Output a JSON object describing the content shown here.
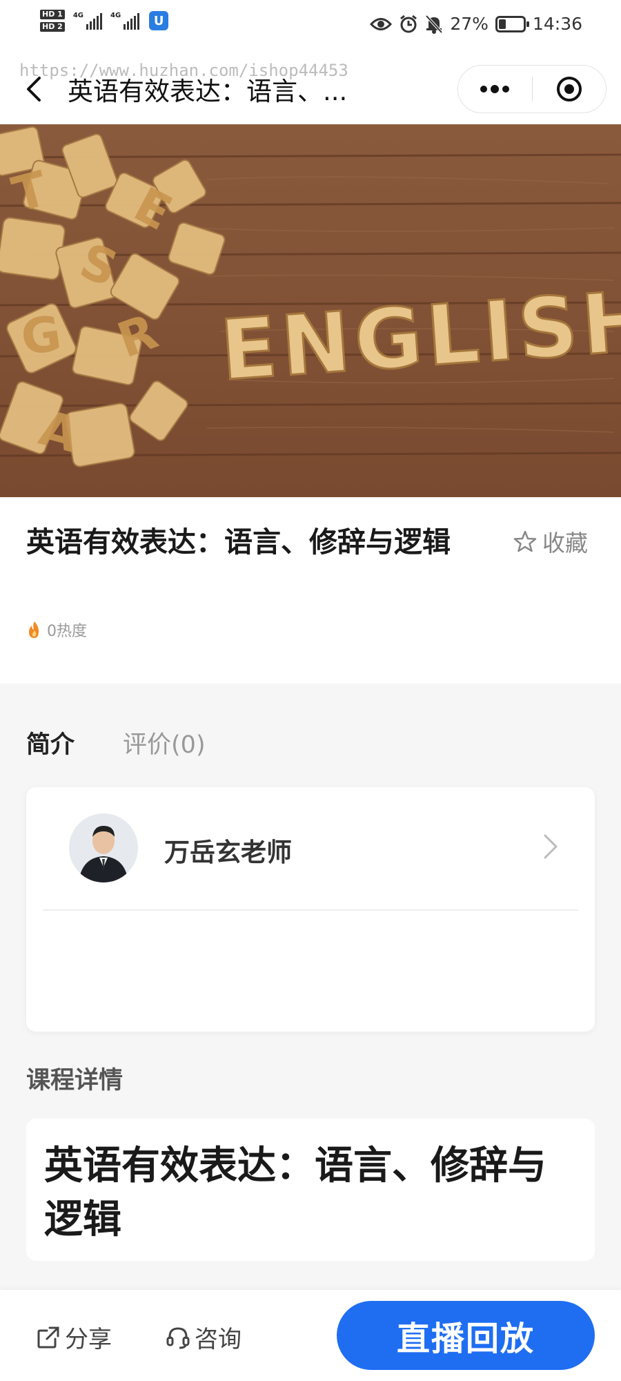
{
  "status_bar": {
    "sim1": "HD 1",
    "sim2": "HD 2",
    "net1": "4G",
    "net2": "4G",
    "battery_percent": "27%",
    "battery_level": 0.27,
    "time": "14:36"
  },
  "nav": {
    "title": "英语有效表达：语言、...",
    "watermark": "https://www.huzhan.com/ishop44453"
  },
  "banner": {
    "word": "ENGLISH"
  },
  "course": {
    "title": "英语有效表达：语言、修辞与逻辑",
    "favorite_label": "收藏",
    "heat": "0热度"
  },
  "tabs": [
    {
      "label": "简介",
      "active": true
    },
    {
      "label": "评价(0)",
      "active": false
    }
  ],
  "teacher": {
    "name": "万岳玄老师"
  },
  "details": {
    "heading": "课程详情",
    "title": "英语有效表达：语言、修辞与逻辑"
  },
  "bottom_bar": {
    "share_label": "分享",
    "consult_label": "咨询",
    "primary_button": "直播回放"
  },
  "colors": {
    "accent": "#1f6ef2",
    "heat_icon": "#f08a24"
  }
}
